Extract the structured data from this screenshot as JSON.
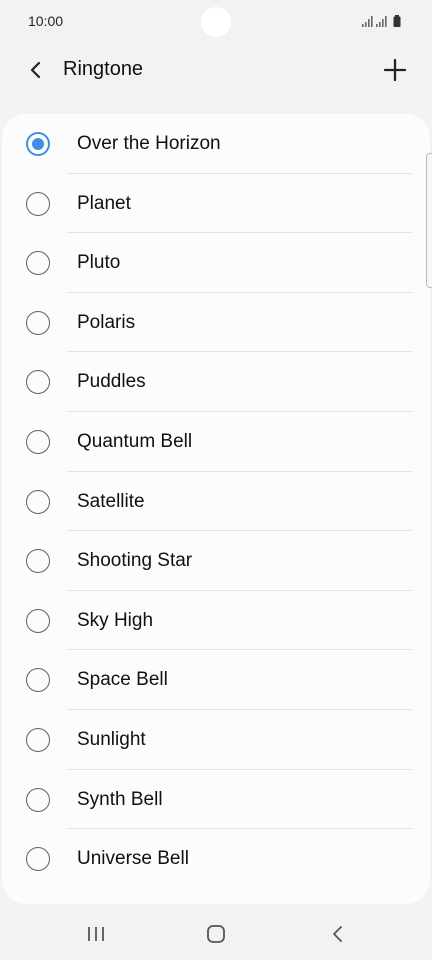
{
  "status_bar": {
    "time": "10:00"
  },
  "header": {
    "title": "Ringtone"
  },
  "ringtones": [
    {
      "label": "Over the Horizon",
      "selected": true
    },
    {
      "label": "Planet",
      "selected": false
    },
    {
      "label": "Pluto",
      "selected": false
    },
    {
      "label": "Polaris",
      "selected": false
    },
    {
      "label": "Puddles",
      "selected": false
    },
    {
      "label": "Quantum Bell",
      "selected": false
    },
    {
      "label": "Satellite",
      "selected": false
    },
    {
      "label": "Shooting Star",
      "selected": false
    },
    {
      "label": "Sky High",
      "selected": false
    },
    {
      "label": "Space Bell",
      "selected": false
    },
    {
      "label": "Sunlight",
      "selected": false
    },
    {
      "label": "Synth Bell",
      "selected": false
    },
    {
      "label": "Universe Bell",
      "selected": false
    }
  ],
  "colors": {
    "accent": "#3e8ded",
    "background": "#f2f2f2",
    "card": "#fcfcfc"
  },
  "icons": {
    "back": "back-arrow-icon",
    "add": "plus-icon",
    "nav_recent": "recent-apps-icon",
    "nav_home": "home-icon",
    "nav_back": "nav-back-icon"
  }
}
